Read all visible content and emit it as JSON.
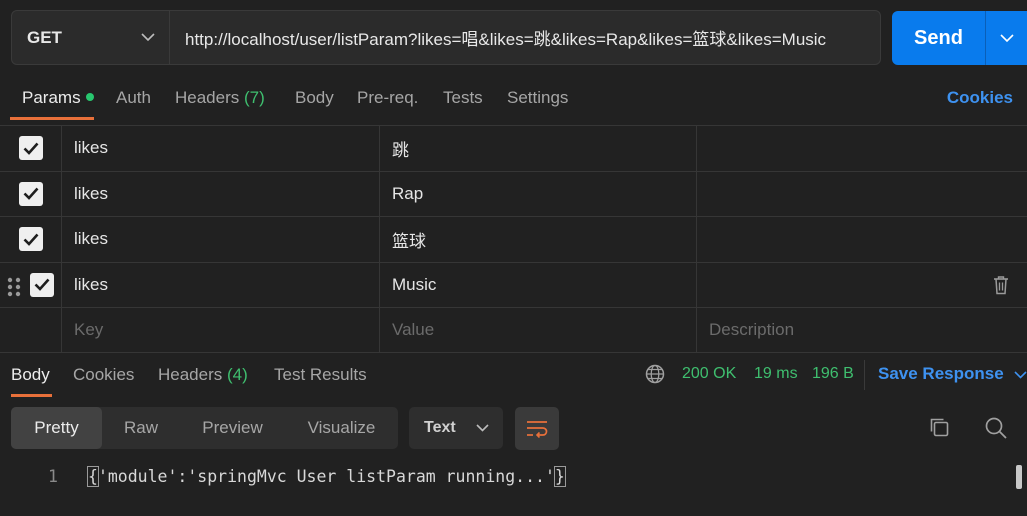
{
  "request": {
    "method": "GET",
    "url": "http://localhost/user/listParam?likes=唱&likes=跳&likes=Rap&likes=篮球&likes=Music",
    "send_label": "Send"
  },
  "request_tabs": {
    "params": "Params",
    "auth": "Auth",
    "headers": "Headers",
    "headers_count": "(7)",
    "body": "Body",
    "prereq": "Pre-req.",
    "tests": "Tests",
    "settings": "Settings",
    "cookies": "Cookies"
  },
  "params": {
    "rows": [
      {
        "key": "likes",
        "value": "跳",
        "description": ""
      },
      {
        "key": "likes",
        "value": "Rap",
        "description": ""
      },
      {
        "key": "likes",
        "value": "篮球",
        "description": ""
      },
      {
        "key": "likes",
        "value": "Music",
        "description": ""
      }
    ],
    "placeholders": {
      "key": "Key",
      "value": "Value",
      "description": "Description"
    }
  },
  "response": {
    "tabs": {
      "body": "Body",
      "cookies": "Cookies",
      "headers": "Headers",
      "headers_count": "(4)",
      "test_results": "Test Results"
    },
    "status": "200 OK",
    "time": "19 ms",
    "size": "196 B",
    "save_label": "Save Response",
    "view_modes": {
      "pretty": "Pretty",
      "raw": "Raw",
      "preview": "Preview",
      "visualize": "Visualize"
    },
    "format": "Text",
    "line_number": "1",
    "brace_open": "{",
    "body_text": "'module':'springMvc User listParam running...'",
    "brace_close": "}"
  },
  "colors": {
    "accent": "#e8703a",
    "send": "#097bed",
    "link": "#3e92f0",
    "status_ok": "#3fbf6f"
  }
}
